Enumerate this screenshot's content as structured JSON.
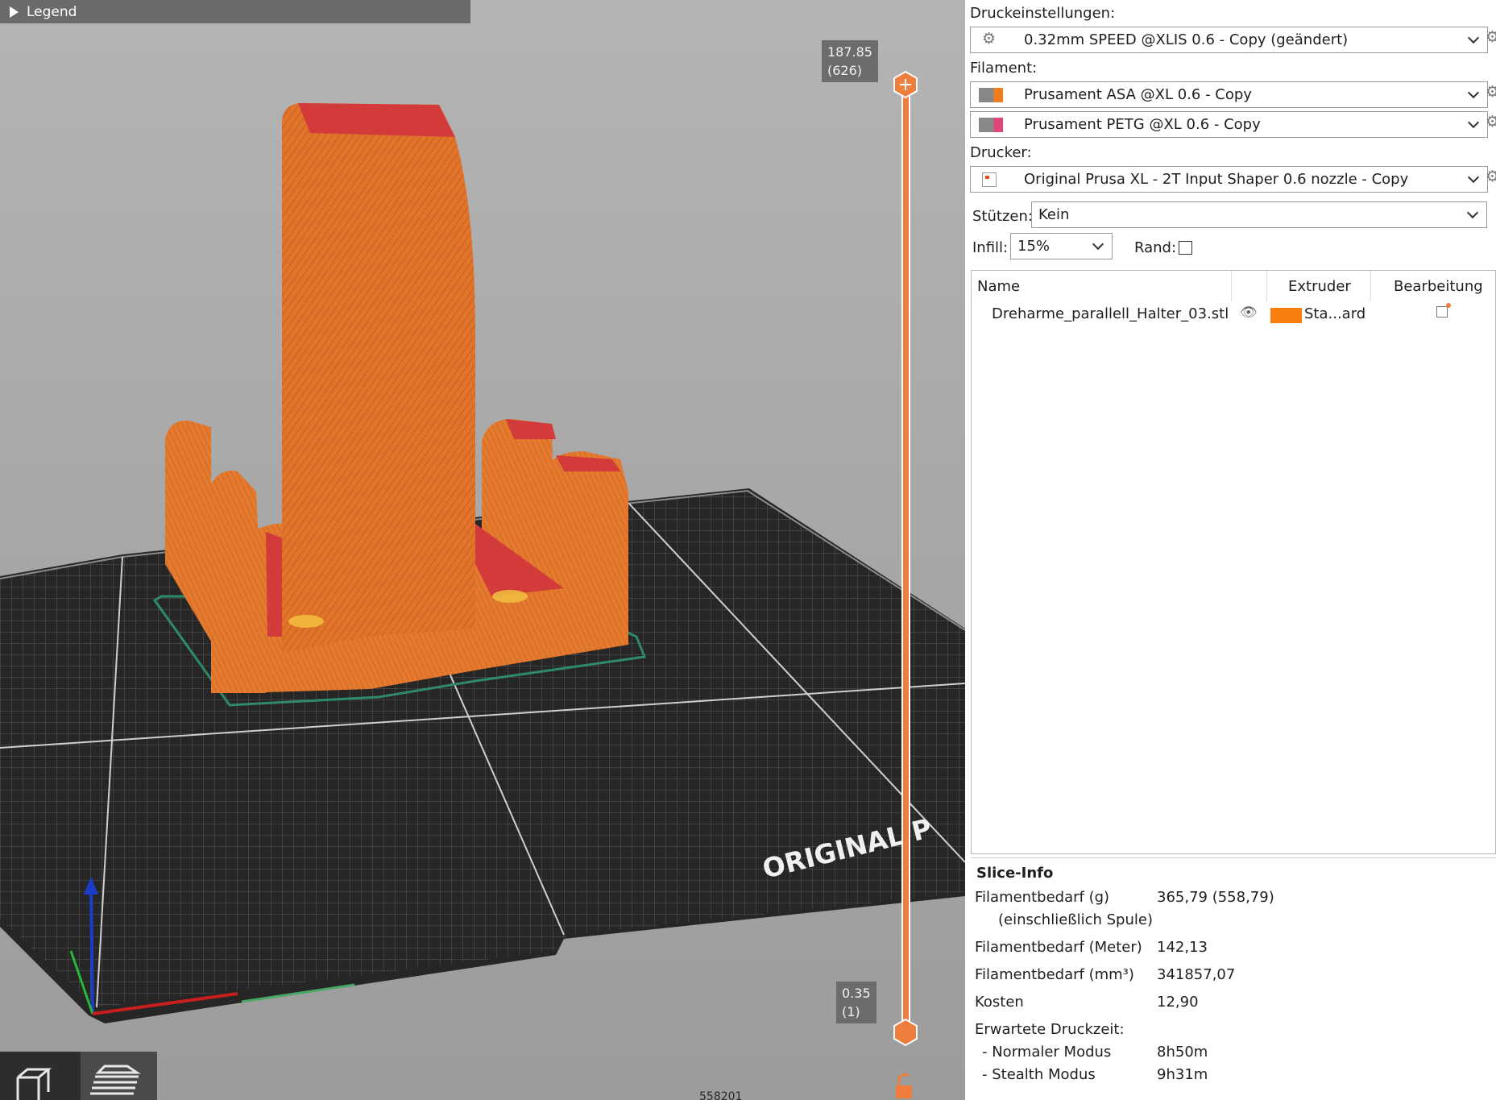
{
  "viewport": {
    "legend_label": "Legend",
    "slider_top_value": "187.85",
    "slider_top_layer": "(626)",
    "slider_bottom_value": "0.35",
    "slider_bottom_layer": "(1)",
    "bed_text": "ORIGINAL P",
    "bottom_counter": "558201",
    "colors": {
      "model": "#e0732a",
      "top": "#d0373a",
      "skirt": "#2f8a6a",
      "slider": "#ef7d3c",
      "bed": "#2a2a2a"
    }
  },
  "sidebar": {
    "print_settings_label": "Druckeinstellungen:",
    "print_settings_value": "0.32mm SPEED @XLIS 0.6 - Copy (geändert)",
    "filament_label": "Filament:",
    "filaments": [
      {
        "name": "Prusament ASA @XL 0.6 - Copy",
        "color": "#f07c1e"
      },
      {
        "name": "Prusament PETG @XL 0.6 - Copy",
        "color": "#e0457b"
      }
    ],
    "printer_label": "Drucker:",
    "printer_value": "Original Prusa XL - 2T Input Shaper 0.6 nozzle - Copy",
    "supports_label": "Stützen:",
    "supports_value": "Kein",
    "infill_label": "Infill:",
    "infill_value": "15%",
    "brim_label": "Rand:",
    "brim_checked": false,
    "table": {
      "col_name": "Name",
      "col_extruder": "Extruder",
      "col_edit": "Bearbeitung",
      "rows": [
        {
          "name": "Dreharme_parallell_Halter_03.stl",
          "extruder": "Sta...ard",
          "color": "#f97d0f"
        }
      ]
    },
    "slice_info": {
      "title": "Slice-Info",
      "filament_g_label": "Filamentbedarf (g)",
      "filament_g_sub": "(einschließlich Spule)",
      "filament_g_value": "365,79 (558,79)",
      "filament_m_label": "Filamentbedarf (Meter)",
      "filament_m_value": "142,13",
      "filament_mm3_label": "Filamentbedarf (mm³)",
      "filament_mm3_value": "341857,07",
      "cost_label": "Kosten",
      "cost_value": "12,90",
      "time_label": "Erwartete Druckzeit:",
      "normal_label": "- Normaler Modus",
      "normal_value": "8h50m",
      "stealth_label": "- Stealth Modus",
      "stealth_value": "9h31m"
    }
  }
}
